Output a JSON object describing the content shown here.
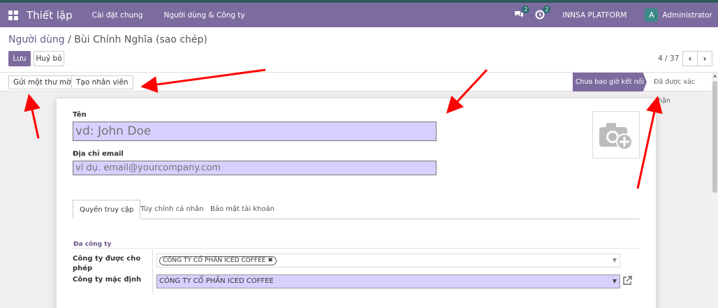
{
  "topbar": {
    "app_title": "Thiết lập",
    "nav": [
      "Cài đặt chung",
      "Người dùng & Công ty"
    ],
    "messages_badge": "2",
    "activities_badge": "2",
    "company": "INNSA PLATFORM",
    "avatar_letter": "A",
    "user": "Administrator"
  },
  "breadcrumb": {
    "parent": "Người dùng",
    "sep": " / ",
    "current": "Bùi Chính Nghĩa (sao chép)"
  },
  "actions": {
    "save": "Lưu",
    "discard": "Huỷ bỏ"
  },
  "pager": {
    "value": "4 / 37",
    "prev": "‹",
    "next": "›"
  },
  "statusbar": {
    "buttons": [
      "Gửi một thư mời",
      "Tạo nhân viên"
    ],
    "stage_active": "Chưa bao giờ kết nối",
    "stage_next": "Đã được xác nhận"
  },
  "form": {
    "name_label": "Tên",
    "name_placeholder": "vd: John Doe",
    "email_label": "Địa chỉ email",
    "email_placeholder": "ví dụ. email@yourcompany.com",
    "tabs": [
      "Quyền truy cập",
      "Tùy chỉnh cá nhân",
      "Bảo mật tài khoản"
    ],
    "group_title": "Đa công ty",
    "allowed_companies_label": "Công ty được cho phép",
    "allowed_companies_tag": "CÔNG TY CỔ PHẦN ICED COFFEE",
    "default_company_label": "Công ty mặc định",
    "default_company_value": "CÔNG TY CỔ PHẦN ICED COFFEE"
  },
  "colors": {
    "brand": "#7c6b9e",
    "input_required": "#d6d1ff",
    "annotation": "#ff0000"
  }
}
